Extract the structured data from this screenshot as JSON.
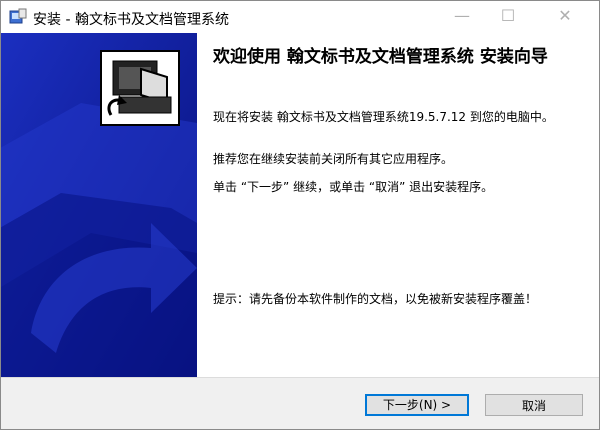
{
  "window": {
    "title": "安装 - 翰文标书及文档管理系统"
  },
  "titlebar": {
    "minimize": "—",
    "maximize": "☐",
    "close": "✕"
  },
  "content": {
    "heading": "欢迎使用 翰文标书及文档管理系统 安装向导",
    "p1": "现在将安装 翰文标书及文档管理系统19.5.7.12 到您的电脑中。",
    "p2": "推荐您在继续安装前关闭所有其它应用程序。",
    "p3": "单击 “下一步” 继续，或单击 “取消” 退出安装程序。",
    "p4": "提示：请先备份本软件制作的文档，以免被新安装程序覆盖！"
  },
  "buttons": {
    "next": "下一步(N) >",
    "cancel": "取消"
  },
  "colors": {
    "sidebar": "#0d1a9a",
    "accent": "#0078d7"
  },
  "icons": {
    "app": "installer-icon",
    "sidebar": "computer-install-icon"
  }
}
